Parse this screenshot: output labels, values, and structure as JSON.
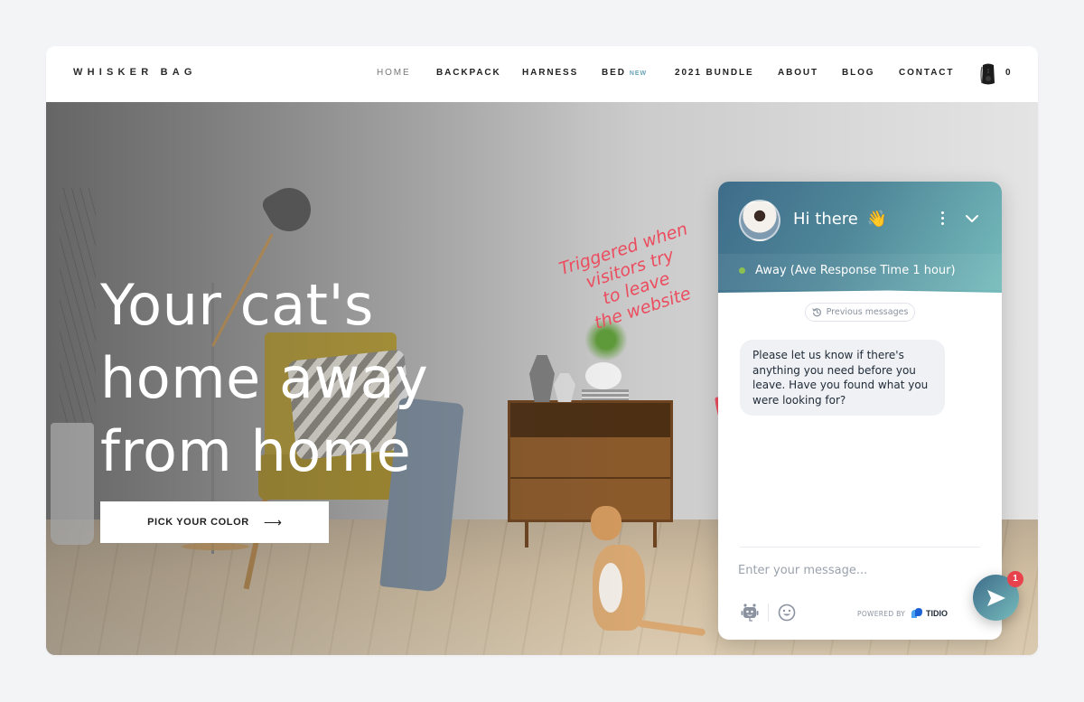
{
  "site": {
    "brand": "WHISKER BAG",
    "nav": [
      {
        "label": "HOME",
        "active": true
      },
      {
        "label": "BACKPACK"
      },
      {
        "label": "HARNESS"
      },
      {
        "label": "BED",
        "badge": "NEW"
      },
      {
        "label": "2021 BUNDLE"
      },
      {
        "label": "ABOUT"
      },
      {
        "label": "BLOG"
      },
      {
        "label": "CONTACT"
      }
    ],
    "cart": {
      "icon": "backpack-cart-icon",
      "count": "0"
    }
  },
  "hero": {
    "title_lines": [
      "Your cat's",
      "home away",
      "from home"
    ],
    "cta_label": "PICK YOUR COLOR",
    "cta_arrow": "⟶"
  },
  "annotation": {
    "lines": [
      "Triggered when",
      "visitors try",
      "to leave",
      "the website"
    ],
    "color": "#eb4d5f"
  },
  "chat": {
    "greeting": "Hi there",
    "greeting_emoji": "👋",
    "status": "Away (Ave Response Time 1 hour)",
    "status_color": "#8cc152",
    "previous_messages_label": "Previous messages",
    "message_lines": [
      "Please let us know if there's",
      "anything you need before you",
      "leave. Have you found what you",
      "were looking for?"
    ],
    "input_placeholder": "Enter your message...",
    "input_value": "",
    "powered_by": "POWERED BY",
    "provider": "TIDIO",
    "launcher_badge": "1",
    "accent_gradient": [
      "#3e6c8a",
      "#76bcbc"
    ]
  }
}
